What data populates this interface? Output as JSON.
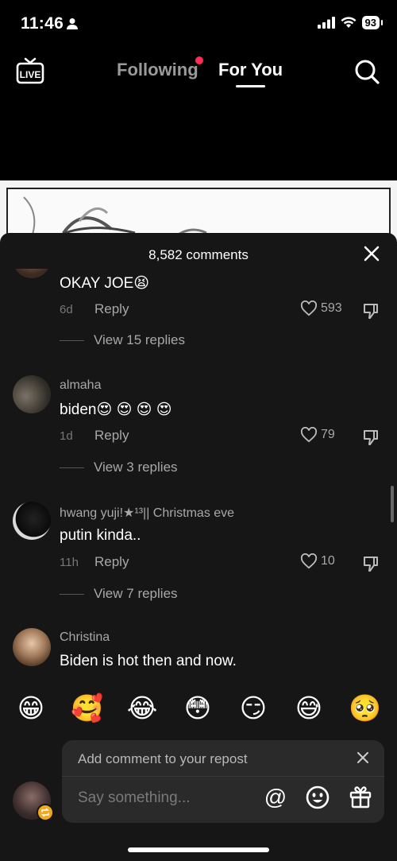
{
  "status_bar": {
    "time": "11:46",
    "battery": "93"
  },
  "top_nav": {
    "live_label": "LIVE",
    "tabs": [
      {
        "label": "Following"
      },
      {
        "label": "For You"
      }
    ],
    "active_tab": "For You"
  },
  "comments": {
    "count_label": "8,582 comments",
    "items": [
      {
        "username": "",
        "text": "OKAY JOE",
        "emoji": "😫",
        "time": "6d",
        "reply_label": "Reply",
        "likes": "593",
        "view_replies": "View 15 replies"
      },
      {
        "username": "almaha",
        "text": "biden",
        "emoji": "😍 😍 😍 😍",
        "time": "1d",
        "reply_label": "Reply",
        "likes": "79",
        "view_replies": "View 3 replies"
      },
      {
        "username": "hwang yuji!★¹³|| Christmas eve",
        "text": "putin kinda..",
        "emoji": "",
        "time": "11h",
        "reply_label": "Reply",
        "likes": "10",
        "view_replies": "View 7 replies"
      },
      {
        "username": "Christina",
        "text": "Biden is hot then and now.",
        "emoji": "",
        "time": "",
        "reply_label": "",
        "likes": "",
        "view_replies": ""
      }
    ]
  },
  "emoji_bar": [
    "😁",
    "🥰",
    "😂",
    "😳",
    "😏",
    "😅",
    "🥺"
  ],
  "composer": {
    "repost_label": "Add comment to your repost",
    "placeholder": "Say something...",
    "mention_symbol": "@"
  },
  "colors": {
    "accent": "#fe2c55",
    "sheet_bg": "#161616",
    "repost_badge": "#f2a91d"
  }
}
